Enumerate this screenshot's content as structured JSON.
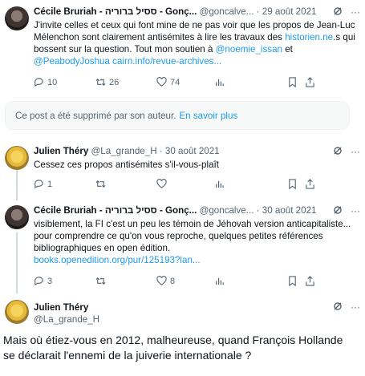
{
  "tweets": [
    {
      "name": "Cécile Bruriah - ססיל ברוריה - Gonç...",
      "handle": "@goncalve...",
      "date": "29 août 2021",
      "text_parts": [
        "J'invite celles et ceux qui font mine de ne pas voir que les propos de Jean-Luc Mélenchon sont clairement antisémites à lire les travaux des ",
        "historien.ne",
        ".s qui bossent sur la question. Tout mon soutien à ",
        "@noemie_issan",
        " et ",
        "@PeabodyJoshua",
        " ",
        "cairn.info/revue-archives...",
        ""
      ],
      "replies": "10",
      "retweets": "26",
      "likes": "74"
    },
    {
      "name": "Julien Théry",
      "handle": "@La_grande_H",
      "date": "30 août 2021",
      "text": "Cessez ces propos antisémites s'il-vous-plaît",
      "replies": "1",
      "retweets": "",
      "likes": ""
    },
    {
      "name": "Cécile Bruriah - ססיל ברוריה - Gonç...",
      "handle": "@goncalve...",
      "date": "30 août 2021",
      "text": "visiblement, la FI c'est un peu les témoin de Jéhovah version anticapitaliste... pour comprendre ce qu'on vous reproche, quelques petites références bibliographiques en open édition.",
      "link": "books.openedition.org/pur/125193?lan...",
      "replies": "3",
      "retweets": "",
      "likes": "8"
    }
  ],
  "deleted_notice": {
    "text": "Ce post a été supprimé par son auteur.",
    "link": "En savoir plus"
  },
  "focus": {
    "name": "Julien Théry",
    "handle": "@La_grande_H",
    "text": "Mais où étiez-vous en 2012, malheureuse, quand François Hollande se déclarait l'ennemi de la juiverie internationale ?"
  },
  "colors": {
    "link": "#1d9bf0",
    "muted": "#536471",
    "text": "#0f1419"
  },
  "icons": [
    "grok-icon",
    "more-icon",
    "reply-icon",
    "retweet-icon",
    "like-icon",
    "views-icon",
    "bookmark-icon",
    "share-icon"
  ]
}
